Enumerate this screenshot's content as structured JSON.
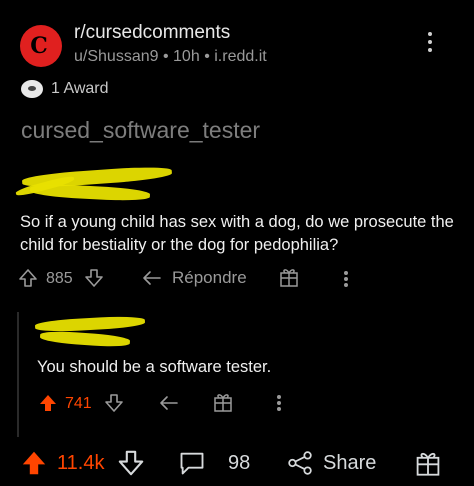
{
  "post": {
    "subreddit": "r/cursedcomments",
    "author": "u/Shussan9",
    "age": "10h",
    "separator": "•",
    "domain": "i.redd.it",
    "awards": "1 Award",
    "title": "cursed_software_tester"
  },
  "comment1": {
    "text": "So if a young child has sex with a dog,  do we prosecute the child for bestiality or the dog for pedophilia?",
    "score": "885",
    "reply_label": "Répondre"
  },
  "comment2": {
    "text": "You should be a software tester.",
    "score": "741"
  },
  "bottom_bar": {
    "upvotes": "11.4k",
    "comments": "98",
    "share_label": "Share"
  },
  "colors": {
    "upvote": "#ff4500",
    "highlight": "#e8e000",
    "logo": "#e0201f"
  }
}
